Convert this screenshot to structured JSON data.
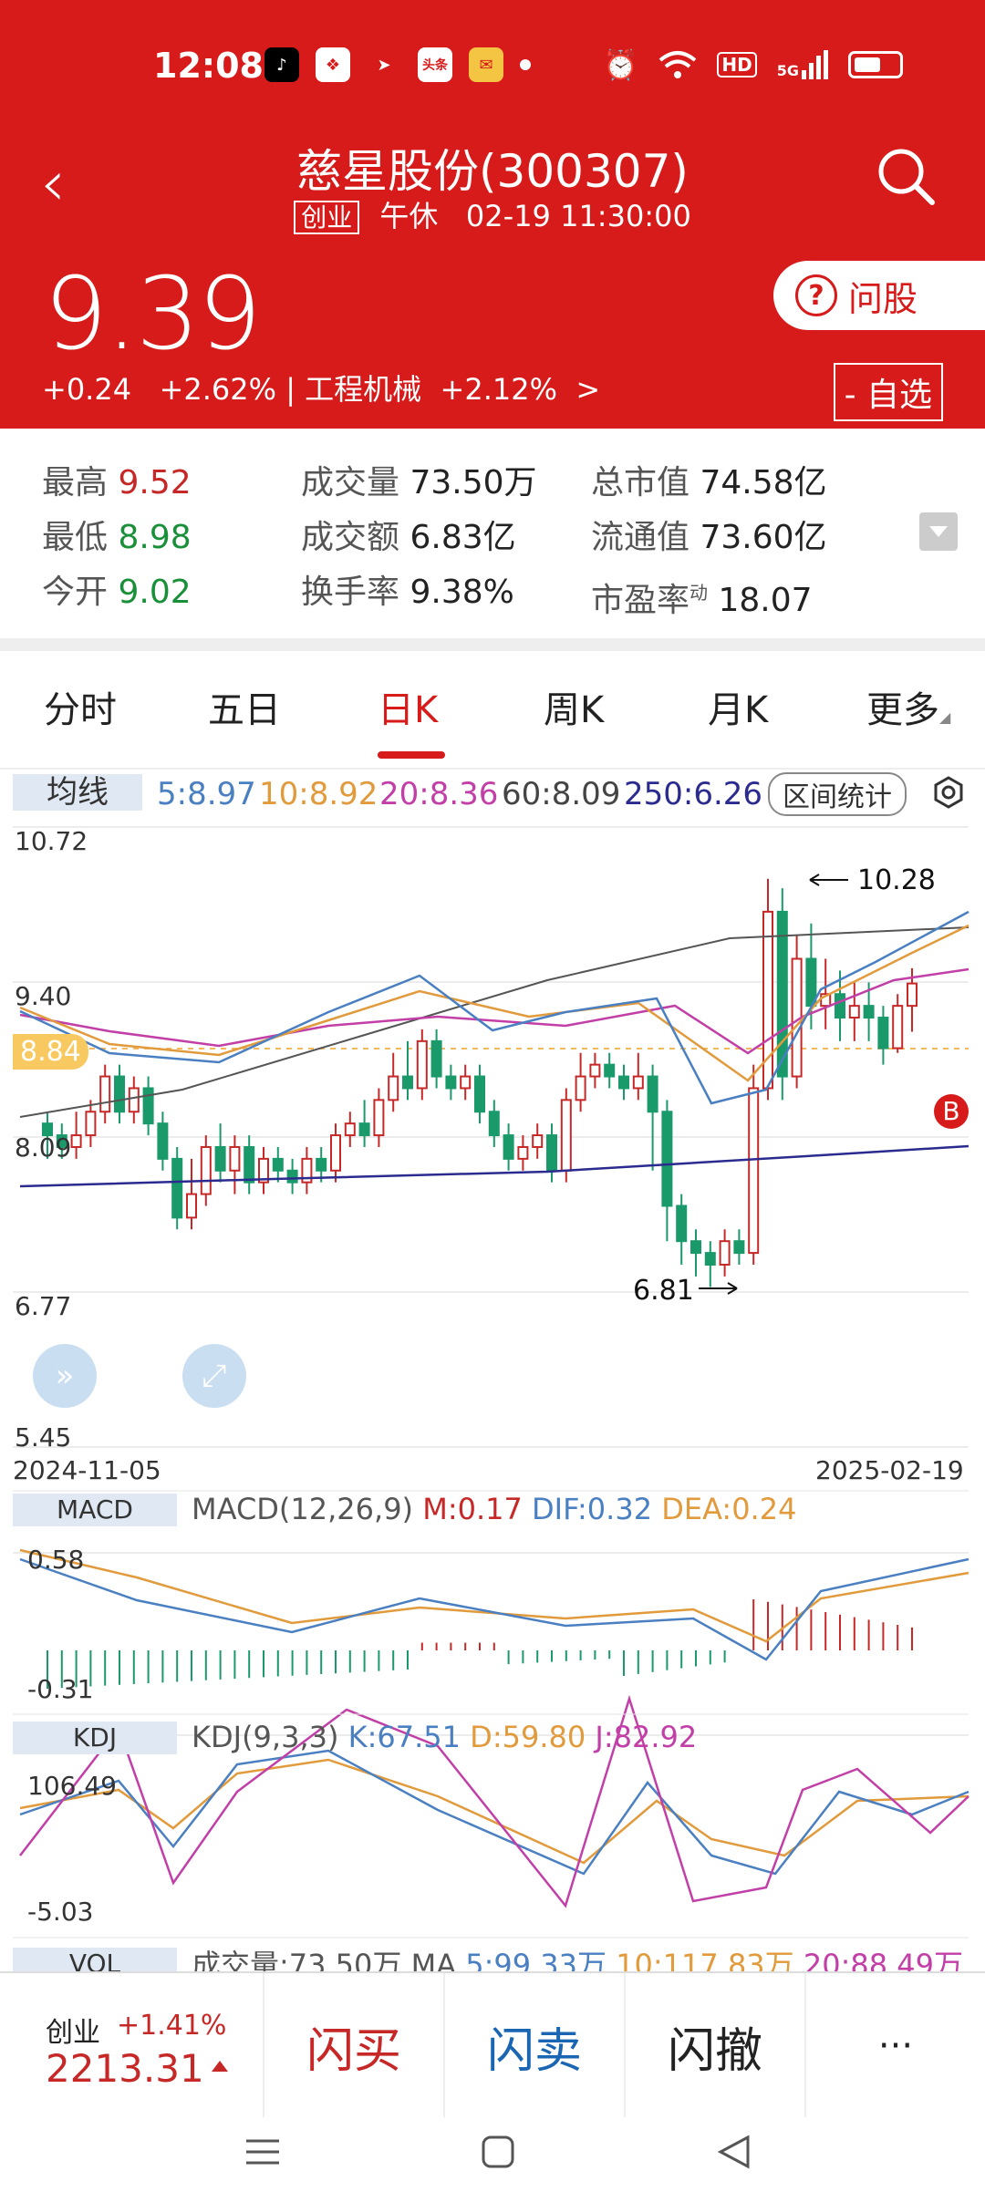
{
  "status_bar": {
    "time": "12:08",
    "hd": "HD",
    "net": "5G"
  },
  "header": {
    "title": "慈星股份(300307)",
    "board": "创业",
    "session": "午休",
    "datetime": "02-19 11:30:00",
    "price": "9.39",
    "change": "+0.24",
    "change_pct": "+2.62%",
    "sector_sep": "|",
    "sector": "工程机械",
    "sector_pct": "+2.12%",
    "sector_arrow": ">",
    "ask_label": "问股",
    "fav_label": "- 自选"
  },
  "quote": {
    "high_label": "最高",
    "high": "9.52",
    "low_label": "最低",
    "low": "8.98",
    "open_label": "今开",
    "open": "9.02",
    "vol_label": "成交量",
    "vol": "73.50万",
    "amt_label": "成交额",
    "amt": "6.83亿",
    "turn_label": "换手率",
    "turn": "9.38%",
    "mcap_label": "总市值",
    "mcap": "74.58亿",
    "float_label": "流通值",
    "float": "73.60亿",
    "pe_label": "市盈率",
    "pe_sup": "动",
    "pe": "18.07"
  },
  "tabs": [
    "分时",
    "五日",
    "日K",
    "周K",
    "月K",
    "更多"
  ],
  "ma": {
    "label": "均线",
    "ma5": "5:8.97",
    "ma10": "10:8.92",
    "ma20": "20:8.36",
    "ma60": "60:8.09",
    "ma250": "250:6.26",
    "interval": "区间统计"
  },
  "kline": {
    "axis": [
      "10.72",
      "9.40",
      "8.09",
      "6.77",
      "5.45"
    ],
    "current": "8.84",
    "high_mark": "10.28",
    "low_mark": "6.81",
    "date_start": "2024-11-05",
    "date_end": "2025-02-19",
    "buy_badge": "B",
    "colors": {
      "up": "#c62828",
      "down": "#1a9a6a"
    }
  },
  "macd": {
    "label": "MACD",
    "params": "MACD(12,26,9)",
    "m": "M:0.17",
    "dif": "DIF:0.32",
    "dea": "DEA:0.24",
    "top": "0.58",
    "bottom": "-0.31"
  },
  "kdj": {
    "label": "KDJ",
    "params": "KDJ(9,3,3)",
    "k": "K:67.51",
    "d": "D:59.80",
    "j": "J:82.92",
    "top": "106.49",
    "bottom": "-5.03"
  },
  "vol": {
    "label": "VOL",
    "text": "成交量:73.50万",
    "ma": "MA",
    "ma5": "5:99.33万",
    "ma10": "10:117.83万",
    "ma20": "20:88.49万"
  },
  "bottom": {
    "index_name": "创业",
    "index_chg": "+1.41%",
    "index_val": "2213.31",
    "buy": "闪买",
    "sell": "闪卖",
    "cancel": "闪撤",
    "more": "···"
  }
}
